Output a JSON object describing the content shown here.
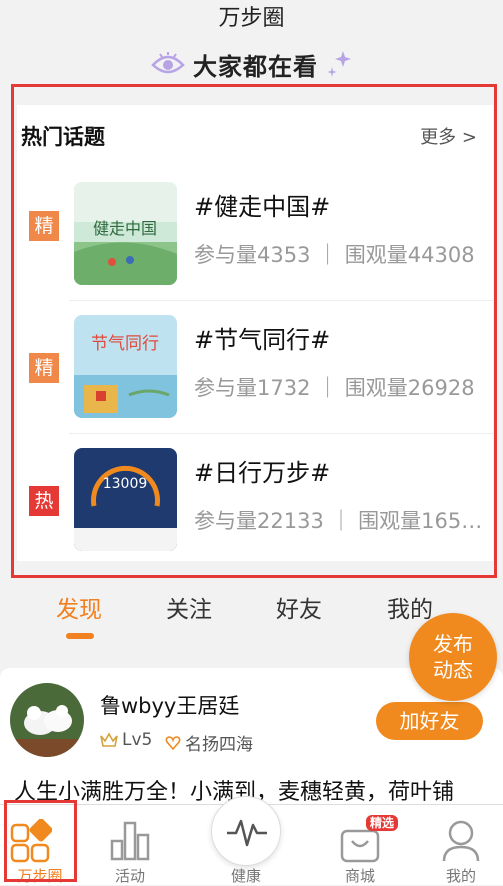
{
  "header": {
    "app_title": "万步圈",
    "section_title": "大家都在看"
  },
  "hot_topics": {
    "title": "热门话题",
    "more": "更多 >",
    "items": [
      {
        "badge": "精",
        "name": "#健走中国#",
        "stats": "参与量4353 ｜ 围观量44308",
        "thumb_text": "健走中国"
      },
      {
        "badge": "精",
        "name": "#节气同行#",
        "stats": "参与量1732 ｜ 围观量26928",
        "thumb_text": "节气同行"
      },
      {
        "badge": "热",
        "name": "#日行万步#",
        "stats": "参与量22133 ｜ 围观量1657...",
        "thumb_text": "13009"
      }
    ]
  },
  "feed_tabs": [
    "发现",
    "关注",
    "好友",
    "我的"
  ],
  "fab": {
    "line1": "发布",
    "line2": "动态"
  },
  "post": {
    "username": "鲁wbyy王居廷",
    "level": "Lv5",
    "title_tag": "名扬四海",
    "add_friend": "加好友",
    "text": "人生小满胜万全！小满到，麦穗轻黄，荷叶铺"
  },
  "bottom_nav": {
    "items": [
      "万步圈",
      "活动",
      "健康",
      "商城",
      "我的"
    ],
    "mall_badge": "精选"
  },
  "colors": {
    "accent": "#f08a1e",
    "highlight_border": "#e53935",
    "badge_jing": "#f0884a",
    "badge_re": "#e53935"
  }
}
